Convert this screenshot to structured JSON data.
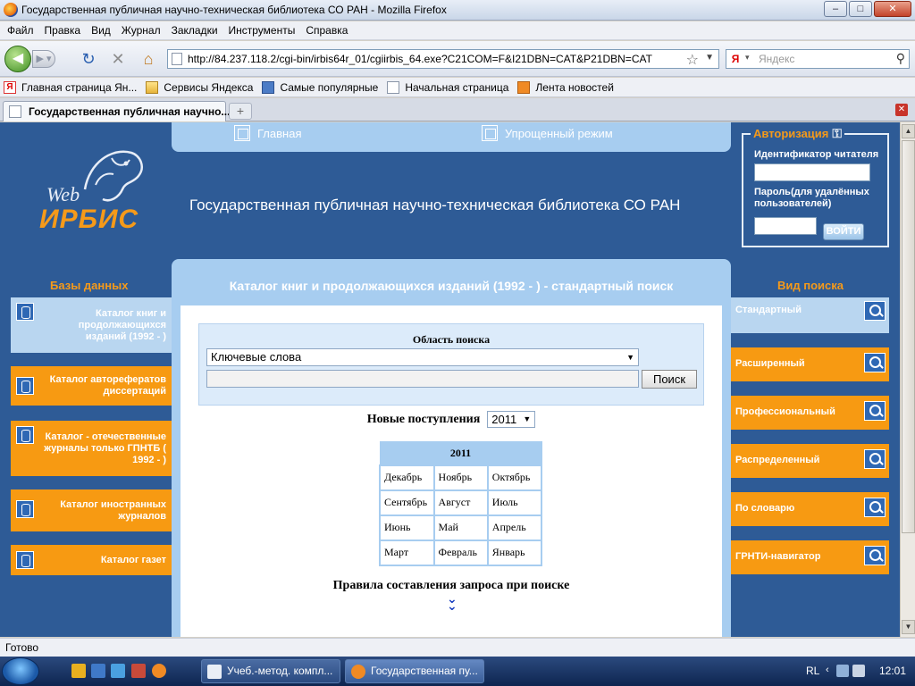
{
  "window": {
    "title": "Государственная публичная научно-техническая библиотека СО РАН - Mozilla Firefox",
    "min": "–",
    "max": "□",
    "close": "✕"
  },
  "menu": [
    "Файл",
    "Правка",
    "Вид",
    "Журнал",
    "Закладки",
    "Инструменты",
    "Справка"
  ],
  "navbar": {
    "url": "http://84.237.118.2/cgi-bin/irbis64r_01/cgiirbis_64.exe?C21COM=F&I21DBN=CAT&P21DBN=CAT",
    "search_placeholder": "Яндекс"
  },
  "bookmarks": [
    {
      "label": "Главная страница Ян...",
      "icon": "yandex-icon"
    },
    {
      "label": "Сервисы Яндекса",
      "icon": "folder-icon"
    },
    {
      "label": "Самые популярные",
      "icon": "popular-icon"
    },
    {
      "label": "Начальная страница",
      "icon": "page-icon"
    },
    {
      "label": "Лента новостей",
      "icon": "rss-icon"
    }
  ],
  "tab": {
    "title": "Государственная публичная научно..."
  },
  "logo": {
    "web": "Web",
    "irbis": "ИРБИС"
  },
  "topnav": {
    "home": "Главная",
    "simple": "Упрощенный режим"
  },
  "library_title": "Государственная публичная научно-техническая библиотека СО РАН",
  "auth": {
    "title": "Авторизация",
    "reader_id_label": "Идентификатор читателя",
    "password_label_1": "Пароль(для удалённых",
    "password_label_2": "пользователей)",
    "login_button": "ВОЙТИ"
  },
  "databases": {
    "title": "Базы данных",
    "items": [
      {
        "lines": [
          "Каталог книг и",
          "продолжающихся",
          "изданий (1992 - )"
        ],
        "active": true
      },
      {
        "lines": [
          "Каталог авторефератов",
          "диссертаций"
        ],
        "active": false
      },
      {
        "lines": [
          "Каталог - отечественные",
          "журналы только ГПНТБ (",
          "1992 - )"
        ],
        "active": false
      },
      {
        "lines": [
          "Каталог иностранных",
          "журналов"
        ],
        "active": false
      },
      {
        "lines": [
          "Каталог газет"
        ],
        "active": false
      }
    ]
  },
  "main": {
    "title": "Каталог книг и продолжающихся изданий (1992 - ) - стандартный поиск",
    "search_area_label": "Область поиска",
    "search_field_selected": "Ключевые слова",
    "search_button": "Поиск",
    "new_arrivals_label": "Новые поступления",
    "year_selected": "2011",
    "calendar": {
      "year": "2011",
      "rows": [
        [
          "Декабрь",
          "Ноябрь",
          "Октябрь"
        ],
        [
          "Сентябрь",
          "Август",
          "Июль"
        ],
        [
          "Июнь",
          "Май",
          "Апрель"
        ],
        [
          "Март",
          "Февраль",
          "Январь"
        ]
      ]
    },
    "rules_label": "Правила составления запроса при поиске"
  },
  "search_types": {
    "title": "Вид поиска",
    "items": [
      "Стандартный",
      "Расширенный",
      "Профессиональный",
      "Распределенный",
      "По словарю",
      "ГРНТИ-навигатор"
    ]
  },
  "status": "Готово",
  "taskbar": {
    "tasks": [
      "Учеб.-метод. компл...",
      "Государственная пу..."
    ],
    "lang": "RL",
    "time": "12:01"
  },
  "colors": {
    "page_bg": "#2e5b96",
    "accent_orange": "#f79a12",
    "panel_light_blue": "#a7cdf0"
  }
}
